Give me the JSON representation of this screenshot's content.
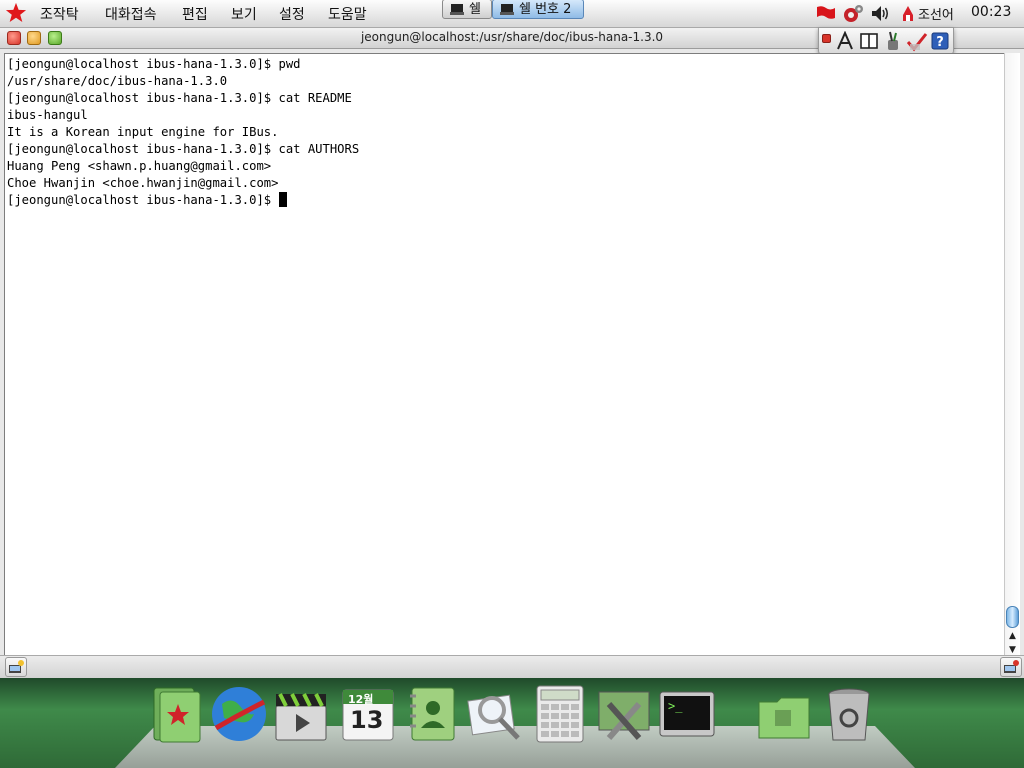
{
  "menubar": {
    "items": [
      "조작탁",
      "대화접속",
      "편집",
      "보기",
      "설정",
      "도움말"
    ],
    "tray": {
      "language": "조선어",
      "clock": "00:23"
    }
  },
  "window": {
    "title": "jeongun@localhost:/usr/share/doc/ibus-hana-1.3.0"
  },
  "terminal": {
    "lines": [
      "[jeongun@localhost ibus-hana-1.3.0]$ pwd",
      "/usr/share/doc/ibus-hana-1.3.0",
      "[jeongun@localhost ibus-hana-1.3.0]$ cat README",
      "ibus-hangul",
      "It is a Korean input engine for IBus.",
      "[jeongun@localhost ibus-hana-1.3.0]$ cat AUTHORS",
      "Huang Peng <shawn.p.huang@gmail.com>",
      "Choe Hwanjin <choe.hwanjin@gmail.com>",
      "[jeongun@localhost ibus-hana-1.3.0]$ "
    ]
  },
  "tabs": [
    {
      "label": "쉘",
      "active": false
    },
    {
      "label": "쉘 번호 2",
      "active": true
    }
  ],
  "dock": {
    "calendar": {
      "month": "12월",
      "day": "13"
    },
    "icons": [
      "documents-icon",
      "browser-globe-icon",
      "video-clapper-icon",
      "calendar-icon",
      "address-book-icon",
      "image-viewer-icon",
      "calculator-icon",
      "system-tools-icon",
      "terminal-icon",
      "folder-icon",
      "trash-icon"
    ]
  },
  "colors": {
    "accent": "#4a84b8",
    "dock_green": "#3f8a4a",
    "star_red": "#e0181b"
  }
}
